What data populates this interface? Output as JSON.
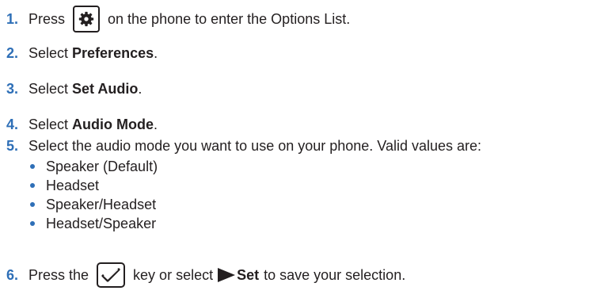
{
  "steps": [
    {
      "num": "1.",
      "before": "Press",
      "after": "on the phone to enter the Options List.",
      "key_icon": "gear-icon"
    },
    {
      "num": "2.",
      "text": "Select ",
      "bold": "Preferences",
      "tail": "."
    },
    {
      "num": "3.",
      "text": "Select ",
      "bold": "Set Audio",
      "tail": "."
    },
    {
      "num": "4.",
      "text": "Select ",
      "bold": "Audio Mode",
      "tail": "."
    },
    {
      "num": "5.",
      "text": "Select the audio mode you want to use on your phone. Valid values are:"
    },
    {
      "num": "6.",
      "before": "Press the",
      "middle": "key or select",
      "bold": "Set",
      "after": "to save your selection.",
      "key_icon": "checkmark-icon",
      "arrow_icon": "right-triangle-icon"
    }
  ],
  "audio_modes": [
    "Speaker (Default)",
    "Headset",
    "Speaker/Headset",
    "Headset/Speaker"
  ],
  "colors": {
    "step_number": "#2e6fb7",
    "text": "#231f20",
    "bullet": "#2e6fb7"
  }
}
